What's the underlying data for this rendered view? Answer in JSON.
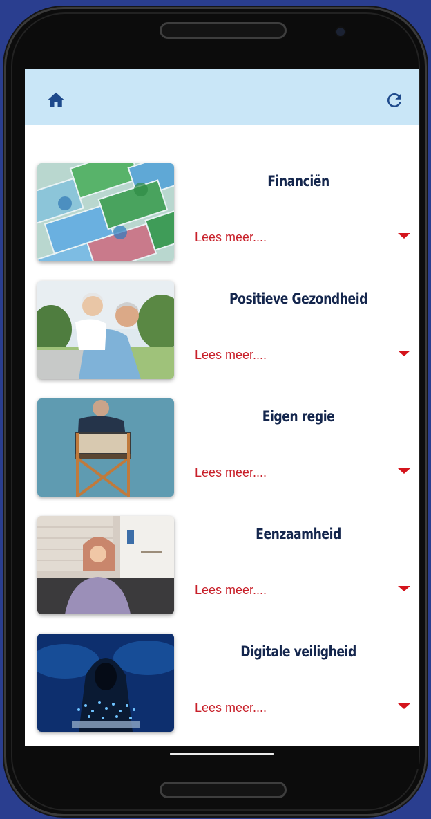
{
  "app_bar": {
    "home_icon": "home-icon",
    "refresh_icon": "refresh-icon",
    "background": "#c9e6f7",
    "icon_color": "#1e4a8c"
  },
  "items": [
    {
      "title": "Financiën",
      "link": "Lees meer....",
      "image": "euro-banknotes"
    },
    {
      "title": "Positieve Gezondheid",
      "link": "Lees meer....",
      "image": "happy-senior-couple"
    },
    {
      "title": "Eigen regie",
      "link": "Lees meer....",
      "image": "man-in-directors-chair"
    },
    {
      "title": "Eenzaamheid",
      "link": "Lees meer....",
      "image": "lonely-woman"
    },
    {
      "title": "Digitale veiligheid",
      "link": "Lees meer....",
      "image": "hooded-hacker"
    }
  ],
  "colors": {
    "title": "#14264d",
    "link": "#c8202a",
    "caret": "#d4141c",
    "page_background": "#2a3e8f"
  }
}
